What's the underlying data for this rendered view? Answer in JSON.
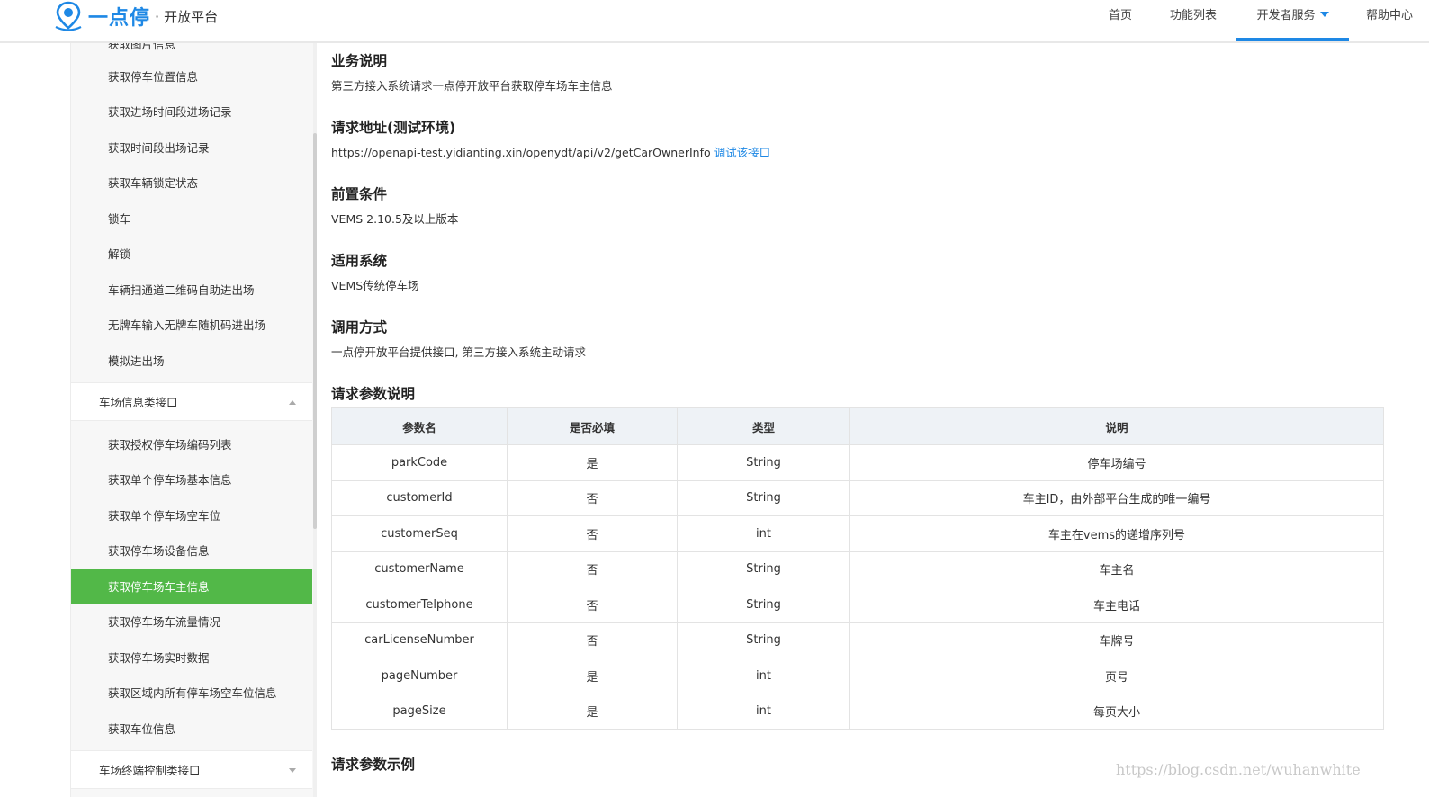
{
  "header": {
    "brand": "一点停",
    "dot": "·",
    "sub": "开放平台",
    "nav": [
      {
        "label": "首页"
      },
      {
        "label": "功能列表"
      },
      {
        "label": "开发者服务"
      },
      {
        "label": "帮助中心"
      }
    ]
  },
  "sidebar": {
    "cut_item": "获取图片信息",
    "items_a": [
      "获取停车位置信息",
      "获取进场时间段进场记录",
      "获取时间段出场记录",
      "获取车辆锁定状态",
      "锁车",
      "解锁",
      "车辆扫通道二维码自助进出场",
      "无牌车输入无牌车随机码进出场",
      "模拟进出场"
    ],
    "group1": "车场信息类接口",
    "items_b": [
      "获取授权停车场编码列表",
      "获取单个停车场基本信息",
      "获取单个停车场空车位",
      "获取停车场设备信息",
      "获取停车场车主信息",
      "获取停车场车流量情况",
      "获取停车场实时数据",
      "获取区域内所有停车场空车位信息",
      "获取车位信息"
    ],
    "group2": "车场终端控制类接口"
  },
  "main": {
    "biz_title": "业务说明",
    "biz_text": "第三方接入系统请求一点停开放平台获取停车场车主信息",
    "url_title": "请求地址(测试环境)",
    "url_text": "https://openapi-test.yidianting.xin/openydt/api/v2/getCarOwnerInfo",
    "url_link": "调试该接口",
    "pre_title": "前置条件",
    "pre_text": "VEMS 2.10.5及以上版本",
    "sys_title": "适用系统",
    "sys_text": "VEMS传统停车场",
    "call_title": "调用方式",
    "call_text": "一点停开放平台提供接口, 第三方接入系统主动请求",
    "param_title": "请求参数说明",
    "example_title": "请求参数示例",
    "table": {
      "headers": [
        "参数名",
        "是否必填",
        "类型",
        "说明"
      ],
      "rows": [
        [
          "parkCode",
          "是",
          "String",
          "停车场编号"
        ],
        [
          "customerId",
          "否",
          "String",
          "车主ID，由外部平台生成的唯一编号"
        ],
        [
          "customerSeq",
          "否",
          "int",
          "车主在vems的递增序列号"
        ],
        [
          "customerName",
          "否",
          "String",
          "车主名"
        ],
        [
          "customerTelphone",
          "否",
          "String",
          "车主电话"
        ],
        [
          "carLicenseNumber",
          "否",
          "String",
          "车牌号"
        ],
        [
          "pageNumber",
          "是",
          "int",
          "页号"
        ],
        [
          "pageSize",
          "是",
          "int",
          "每页大小"
        ]
      ]
    }
  },
  "watermark": "https://blog.csdn.net/wuhanwhite",
  "colors": {
    "accent": "#1e88e5",
    "active_green": "#52b848"
  }
}
